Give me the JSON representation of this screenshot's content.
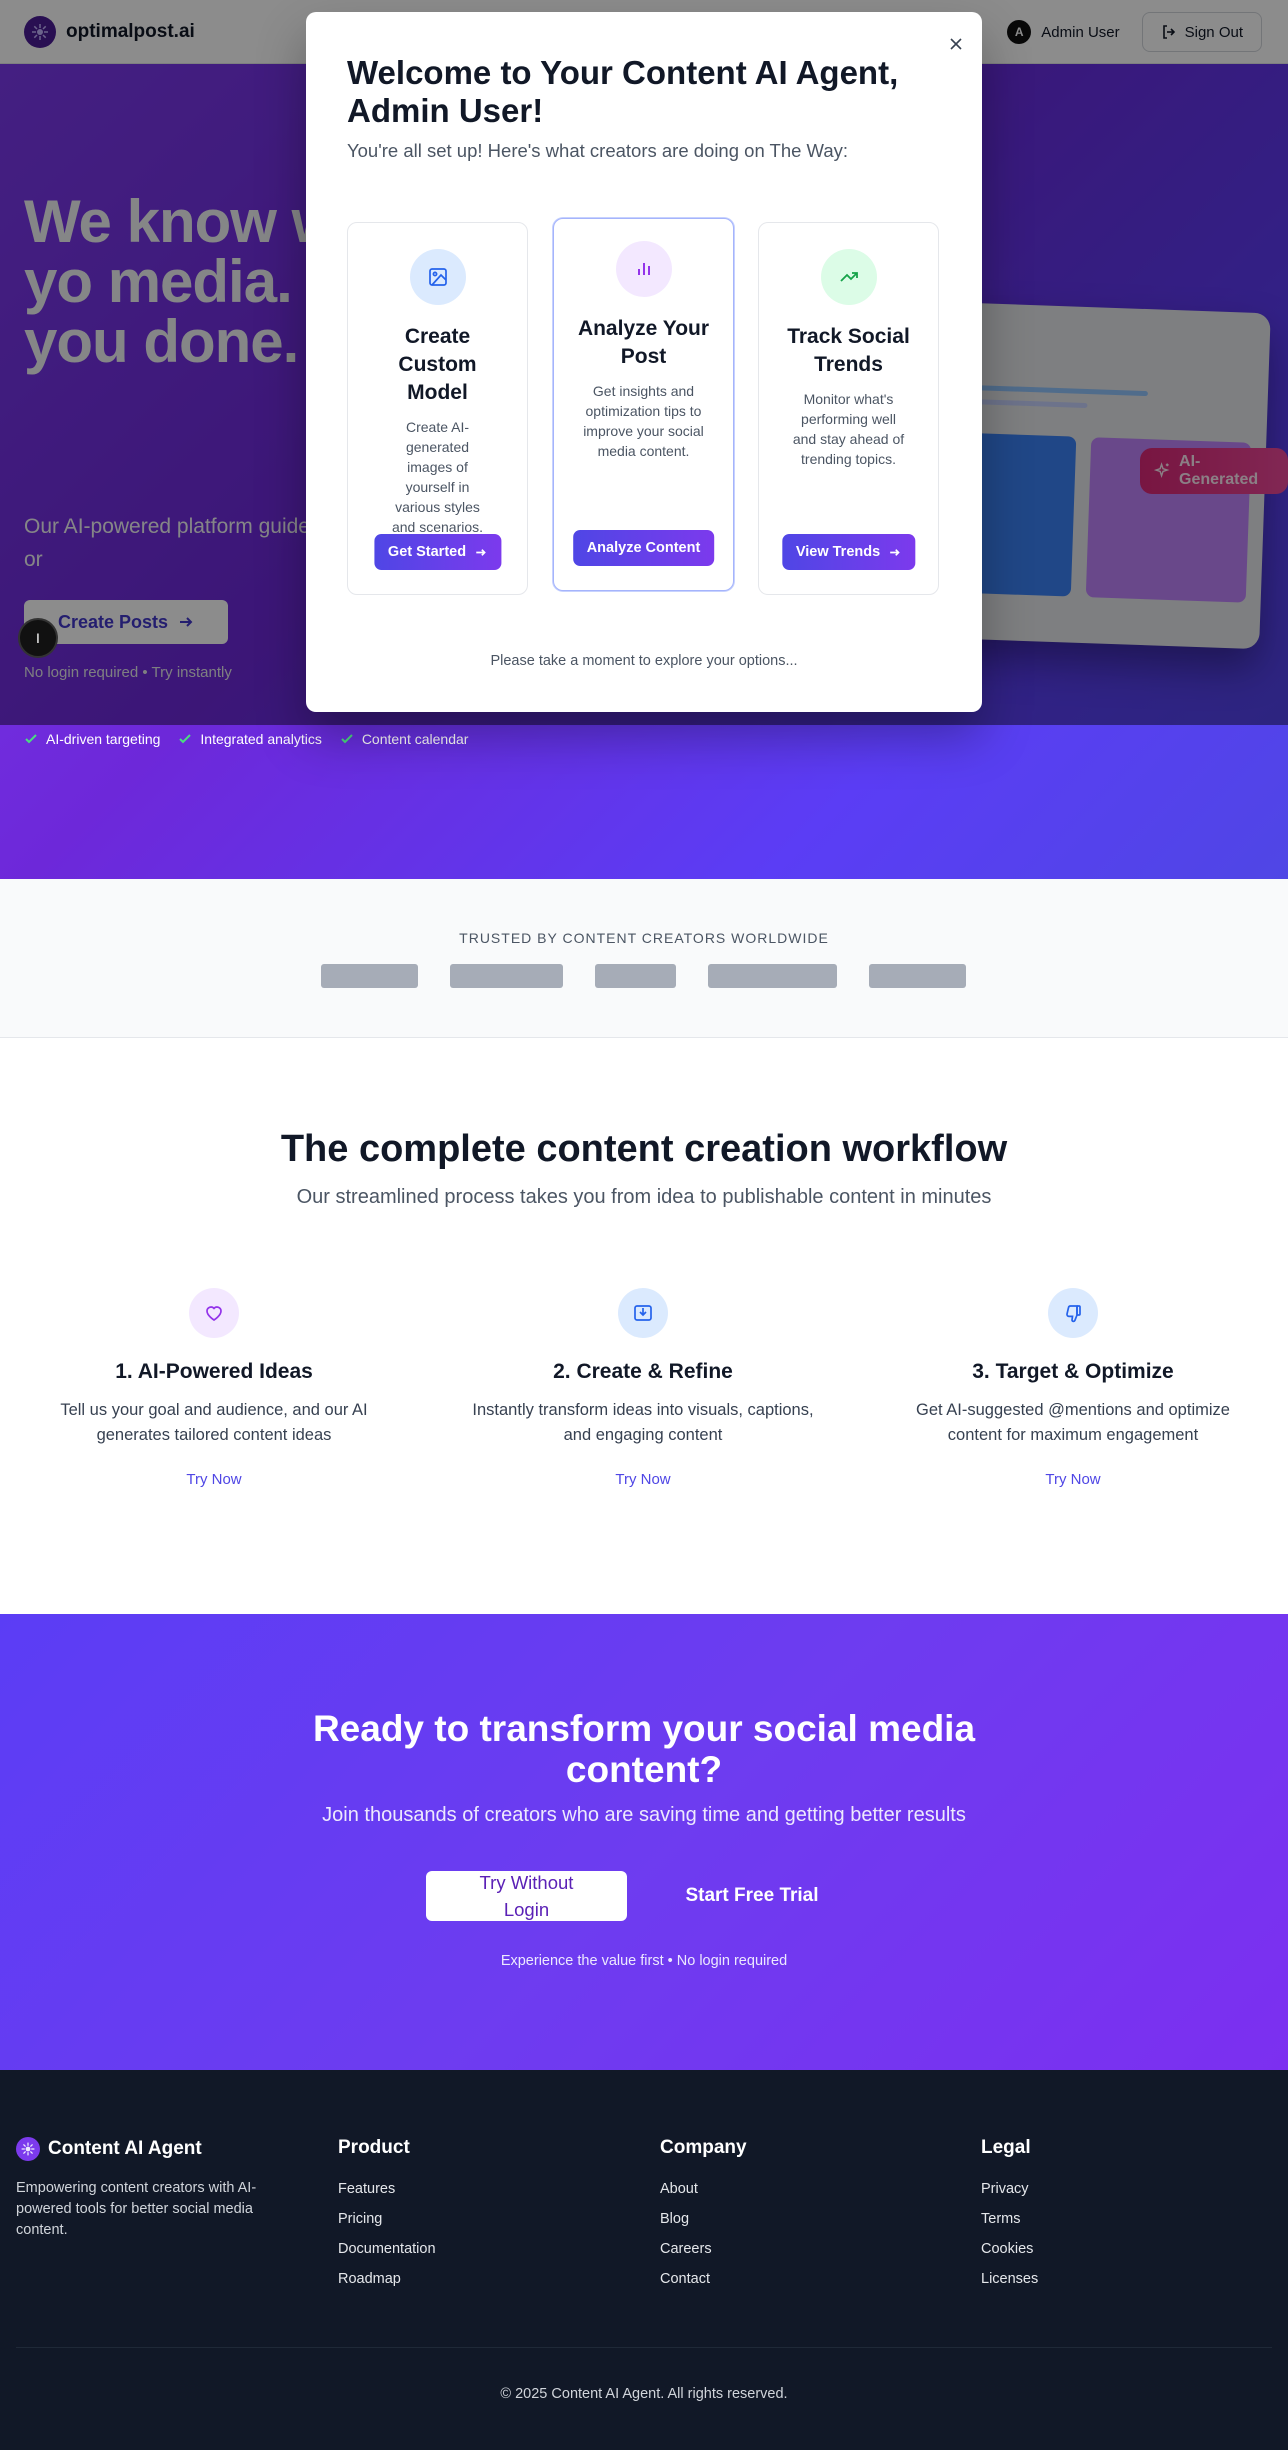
{
  "header": {
    "brand": "optimalpost.ai",
    "user_initial": "A",
    "user_name": "Admin User",
    "signout_label": "Sign Out"
  },
  "hero": {
    "title": "We know w best for yo media. We show you done.",
    "subtitle": "Our AI-powered platform guide targeting, and distribution in or",
    "cta_label": "Create Posts",
    "note": "No login required • Try instantly",
    "badge": "AI-Generated",
    "chat_initial": "I",
    "checks": [
      "AI-driven targeting",
      "Integrated analytics",
      "Content calendar"
    ]
  },
  "modal": {
    "title": "Welcome to Your Content AI Agent, Admin User!",
    "subtitle": "You're all set up! Here's what creators are doing on The Way:",
    "cards": [
      {
        "title": "Create Custom Model",
        "description": "Create AI-generated images of yourself in various styles and scenarios.",
        "button": "Get Started",
        "icon": "image-icon"
      },
      {
        "title": "Analyze Your Post",
        "description": "Get insights and optimization tips to improve your social media content.",
        "button": "Analyze Content",
        "icon": "bar-chart-icon"
      },
      {
        "title": "Track Social Trends",
        "description": "Monitor what's performing well and stay ahead of trending topics.",
        "button": "View Trends",
        "icon": "trending-up-icon"
      }
    ],
    "footer": "Please take a moment to explore your options..."
  },
  "trusted": {
    "title": "TRUSTED BY CONTENT CREATORS WORLDWIDE"
  },
  "workflow": {
    "title": "The complete content creation workflow",
    "subtitle": "Our streamlined process takes you from idea to publishable content in minutes",
    "steps": [
      {
        "title": "1. AI-Powered Ideas",
        "description": "Tell us your goal and audience, and our AI generates tailored content ideas",
        "link": "Try Now",
        "icon": "heart-icon"
      },
      {
        "title": "2. Create & Refine",
        "description": "Instantly transform ideas into visuals, captions, and engaging content",
        "link": "Try Now",
        "icon": "download-icon"
      },
      {
        "title": "3. Target & Optimize",
        "description": "Get AI-suggested @mentions and optimize content for maximum engagement",
        "link": "Try Now",
        "icon": "thumbs-down-icon"
      }
    ]
  },
  "cta": {
    "title": "Ready to transform your social media content?",
    "subtitle": "Join thousands of creators who are saving time and getting better results",
    "primary": "Try Without Login",
    "secondary": "Start Free Trial",
    "note": "Experience the value first • No login required"
  },
  "footer": {
    "brand": "Content AI Agent",
    "tagline": "Empowering content creators with AI-powered tools for better social media content.",
    "columns": [
      {
        "title": "Product",
        "links": [
          "Features",
          "Pricing",
          "Documentation",
          "Roadmap"
        ]
      },
      {
        "title": "Company",
        "links": [
          "About",
          "Blog",
          "Careers",
          "Contact"
        ]
      },
      {
        "title": "Legal",
        "links": [
          "Privacy",
          "Terms",
          "Cookies",
          "Licenses"
        ]
      }
    ],
    "copyright": "© 2025 Content AI Agent. All rights reserved."
  },
  "colors": {
    "primary": "#4f46e5",
    "accent": "#7c3aed",
    "footer_bg": "#111827",
    "badge": "#ec4899"
  }
}
